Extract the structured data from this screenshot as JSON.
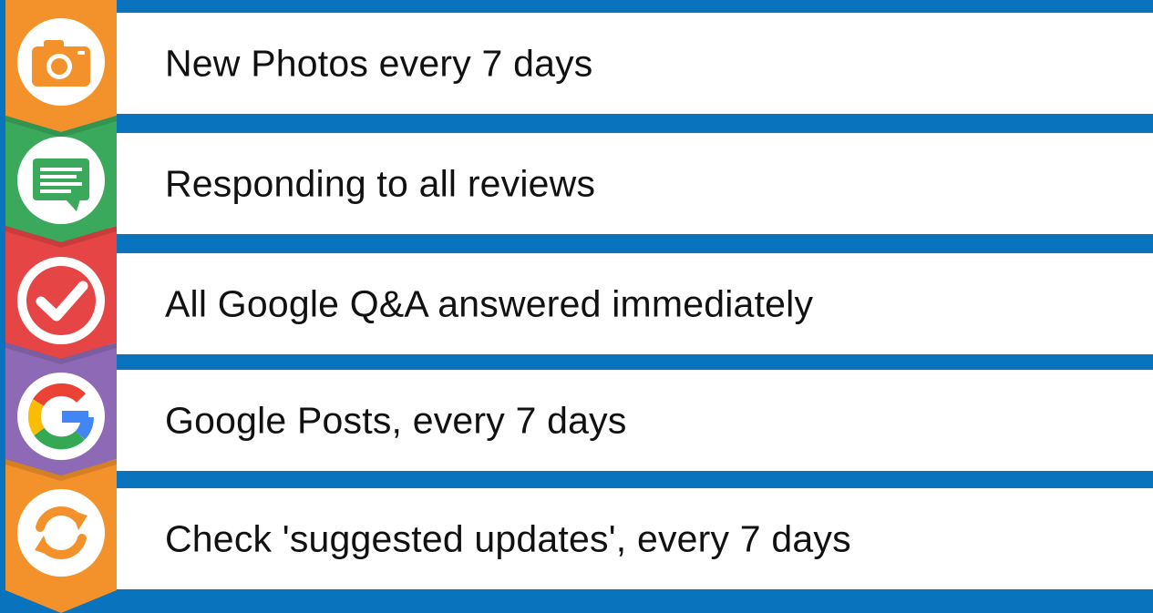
{
  "items": [
    {
      "label": "New Photos every 7 days",
      "icon": "camera-icon",
      "color": "#f3922b"
    },
    {
      "label": "Responding to all reviews",
      "icon": "comment-icon",
      "color": "#3aa95b"
    },
    {
      "label": "All Google Q&A answered immediately",
      "icon": "checkmark-icon",
      "color": "#e64545"
    },
    {
      "label": "Google Posts, every 7 days",
      "icon": "google-icon",
      "color": "#8e6ab6"
    },
    {
      "label": "Check 'suggested updates', every 7 days",
      "icon": "refresh-icon",
      "color": "#f3922b"
    }
  ],
  "colors": {
    "background": "#0a73bd",
    "card": "#ffffff",
    "text": "#111111"
  }
}
